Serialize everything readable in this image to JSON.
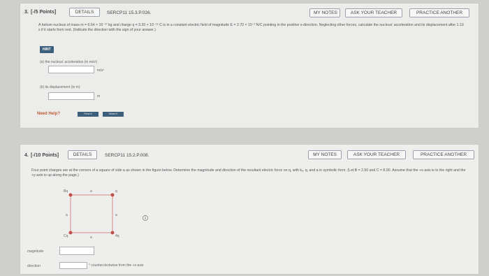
{
  "q3": {
    "number": "3.",
    "points": "[-/5 Points]",
    "details": "DETAILS",
    "code": "SERCP11 15.3.P.026.",
    "my_notes": "MY NOTES",
    "ask": "ASK YOUR TEACHER",
    "practice": "PRACTICE ANOTHER",
    "text": "A helium nucleus of mass m = 6.64 × 10⁻²⁷ kg and charge q = 3.20 × 10⁻¹⁹ C is in a constant electric field of magnitude E = 2.70 × 10⁻³ N/C pointing in the positive x-direction. Neglecting other forces, calculate the nucleus' acceleration and its displacement after 1.10 s if it starts from rest. (Indicate the direction with the sign of your answer.)",
    "hint": "HINT",
    "part_a_label": "(a)   the nucleus' acceleration (in m/s²)",
    "part_a_unit": "m/s²",
    "part_b_label": "(b)   its displacement (in m)",
    "part_b_unit": "m",
    "need_help": "Need Help?",
    "read_it": "Read It",
    "watch_it": "Watch It"
  },
  "q4": {
    "number": "4.",
    "points": "[-/10 Points]",
    "details": "DETAILS",
    "code": "SERCP11 15.2.P.008.",
    "my_notes": "MY NOTES",
    "ask": "ASK YOUR TEACHER",
    "practice": "PRACTICE ANOTHER",
    "text": "Four point charges are at the corners of a square of side a as shown in the figure below. Determine the magnitude and direction of the resultant electric force on q, with kₑ, q, and a in symbolic form. (Let B = 2.50 and C = 8.00. Assume that the +x-axis is to the right and the +y-axis is up along the page.)",
    "fig_q": "q",
    "fig_a_top": "a",
    "fig_a_left": "a",
    "fig_a_right": "a",
    "fig_a_bottom": "a",
    "fig_bq": "Bq",
    "fig_cq": "Cq",
    "fig_4q": "4q",
    "magnitude_label": "magnitude",
    "direction_label": "direction",
    "direction_unit": "° counterclockwise from the +x-axis"
  }
}
